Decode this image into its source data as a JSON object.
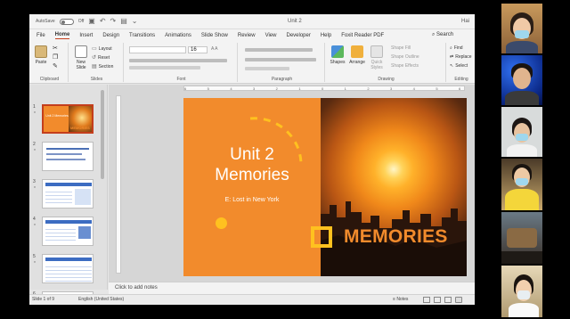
{
  "title_bar": {
    "autosave_label": "AutoSave",
    "toggle_state": "Off",
    "doc_title": "Unit 2",
    "user": "Hai"
  },
  "menu": {
    "tabs": [
      "File",
      "Home",
      "Insert",
      "Design",
      "Transitions",
      "Animations",
      "Slide Show",
      "Review",
      "View",
      "Developer",
      "Help",
      "Foxit Reader PDF"
    ],
    "active": "Home",
    "search": "Search"
  },
  "ribbon": {
    "clipboard": {
      "paste": "Paste",
      "label": "Clipboard"
    },
    "slides": {
      "new_slide": "New Slide",
      "layout": "Layout",
      "reset": "Reset",
      "section": "Section",
      "label": "Slides"
    },
    "font": {
      "size": "16",
      "label": "Font"
    },
    "paragraph": {
      "label": "Paragraph"
    },
    "drawing": {
      "shapes": "Shapes",
      "arrange": "Arrange",
      "quick_styles": "Quick Styles",
      "shape_fill": "Shape Fill",
      "shape_outline": "Shape Outline",
      "shape_effects": "Shape Effects",
      "label": "Drawing"
    },
    "editing": {
      "find": "Find",
      "replace": "Replace",
      "select": "Select",
      "label": "Editing"
    }
  },
  "thumbnails": [
    {
      "num": "1",
      "star": "*",
      "title": "Unit 2 Memories",
      "logo": "MEMORIES"
    },
    {
      "num": "2",
      "star": "*"
    },
    {
      "num": "3",
      "star": "*"
    },
    {
      "num": "4",
      "star": "*"
    },
    {
      "num": "5",
      "star": "*"
    },
    {
      "num": "6",
      "star": "*"
    }
  ],
  "ruler": {
    "h_ticks": [
      "6",
      "5",
      "4",
      "3",
      "2",
      "1",
      "0",
      "1",
      "2",
      "3",
      "4",
      "5",
      "6"
    ]
  },
  "slide": {
    "title_line1": "Unit 2",
    "title_line2": "Memories",
    "subtitle": "E: Lost in New York",
    "logo_text": "MEMORIES"
  },
  "notes": {
    "placeholder": "Click to add notes"
  },
  "status": {
    "slide": "Slide 1 of 9",
    "language": "English (United States)",
    "notes": "Notes"
  },
  "colors": {
    "slide_orange": "#f28b2c",
    "accent_yellow": "#ffc11f",
    "ppt_accent": "#c43e1c"
  }
}
